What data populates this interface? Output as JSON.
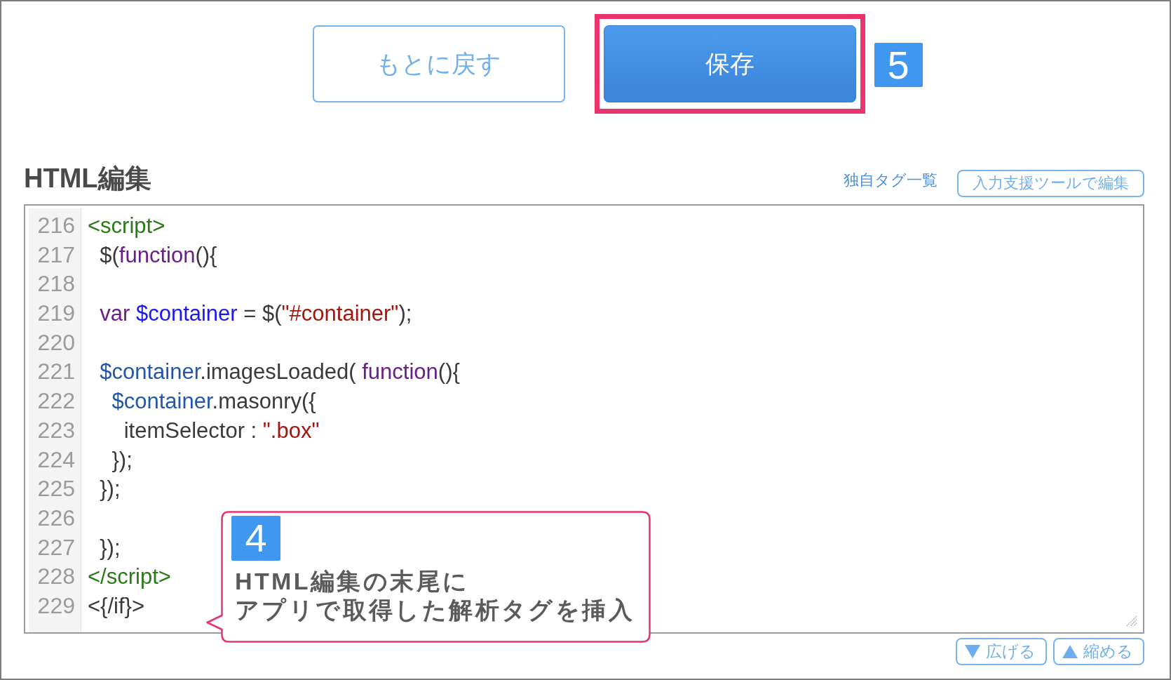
{
  "actions": [
    {
      "kind": "outline",
      "label": "もとに戻す",
      "highlighted": false
    },
    {
      "kind": "primary",
      "label": "保存",
      "highlighted": true,
      "step": "5"
    }
  ],
  "editor": {
    "title": "HTML編集",
    "tools": [
      {
        "kind": "link",
        "label": "独自タグ一覧"
      },
      {
        "kind": "button",
        "label": "入力支援ツールで編集"
      }
    ],
    "lines": [
      {
        "number": "216",
        "tokens": [
          {
            "kind": "tag",
            "text": "<script>"
          }
        ]
      },
      {
        "number": "217",
        "tokens": [
          {
            "kind": "plain",
            "text": "  $("
          },
          {
            "kind": "keyword",
            "text": "function"
          },
          {
            "kind": "plain",
            "text": "(){"
          }
        ]
      },
      {
        "number": "218"
      },
      {
        "number": "219",
        "tokens": [
          {
            "kind": "keyword",
            "text": "  var "
          },
          {
            "kind": "def",
            "text": "$container"
          },
          {
            "kind": "plain",
            "text": " = $("
          },
          {
            "kind": "string",
            "text": "\"#container\""
          },
          {
            "kind": "plain",
            "text": ");"
          }
        ]
      },
      {
        "number": "220"
      },
      {
        "number": "221",
        "tokens": [
          {
            "kind": "variable",
            "text": "  $container"
          },
          {
            "kind": "plain",
            "text": ".imagesLoaded( "
          },
          {
            "kind": "keyword",
            "text": "function"
          },
          {
            "kind": "plain",
            "text": "(){"
          }
        ]
      },
      {
        "number": "222",
        "tokens": [
          {
            "kind": "variable",
            "text": "    $container"
          },
          {
            "kind": "plain",
            "text": ".masonry({"
          }
        ]
      },
      {
        "number": "223",
        "tokens": [
          {
            "kind": "plain",
            "text": "      itemSelector : "
          },
          {
            "kind": "string",
            "text": "\".box\""
          }
        ]
      },
      {
        "number": "224",
        "tokens": [
          {
            "kind": "plain",
            "text": "    });"
          }
        ]
      },
      {
        "number": "225",
        "tokens": [
          {
            "kind": "plain",
            "text": "  });"
          }
        ]
      },
      {
        "number": "226"
      },
      {
        "number": "227",
        "tokens": [
          {
            "kind": "plain",
            "text": "  });"
          }
        ]
      },
      {
        "number": "228",
        "tokens": [
          {
            "kind": "tag",
            "text": "</script>"
          }
        ]
      },
      {
        "number": "229",
        "tokens": [
          {
            "kind": "plain",
            "text": "<{/if}>"
          }
        ]
      }
    ],
    "resize_buttons": [
      {
        "kind": "expand",
        "label": "広げる"
      },
      {
        "kind": "shrink",
        "label": "縮める"
      }
    ]
  },
  "callout": {
    "step": "4",
    "lines": [
      "HTML編集の末尾に",
      "アプリで取得した解析タグを挿入"
    ]
  }
}
